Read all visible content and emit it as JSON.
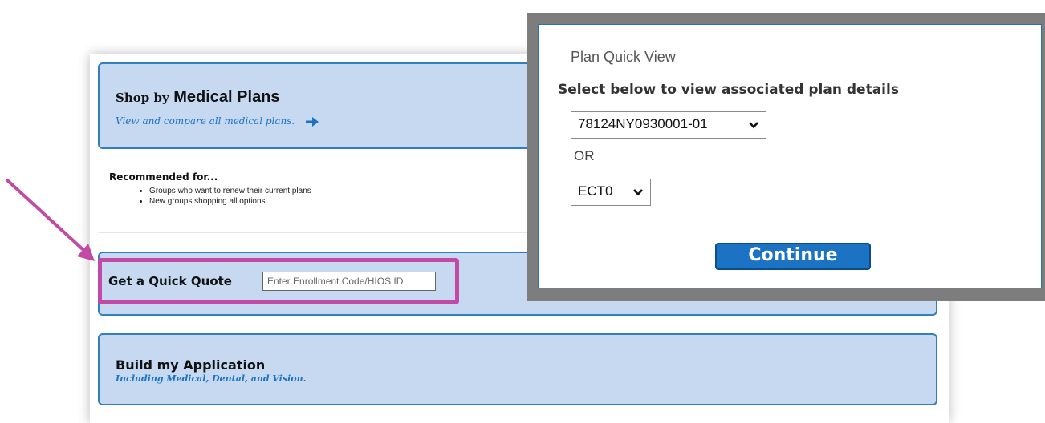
{
  "shop": {
    "title_small": "Shop by",
    "title_big": "Medical Plans",
    "link": "View and compare all medical plans.",
    "arrow_icon": "arrow-right-icon"
  },
  "recommended": {
    "title": "Recommended for...",
    "items": [
      "Groups who want to renew their current plans",
      "New groups shopping all options"
    ]
  },
  "quick_quote": {
    "label": "Get a Quick Quote",
    "input_placeholder": "Enter Enrollment Code/HIOS ID"
  },
  "build": {
    "title": "Build my Application",
    "subtitle": "Including Medical, Dental, and Vision."
  },
  "modal": {
    "title": "Plan Quick View",
    "instruction": "Select below to view associated plan details",
    "plan_select_value": "78124NY0930001-01",
    "or_label": "OR",
    "code_select_value": "ECT0",
    "continue_label": "Continue"
  },
  "colors": {
    "card_bg": "#c6d9f0",
    "card_border": "#2f7fc2",
    "highlight": "#c24aa4",
    "link": "#1a73c2",
    "button": "#1c73c4"
  }
}
